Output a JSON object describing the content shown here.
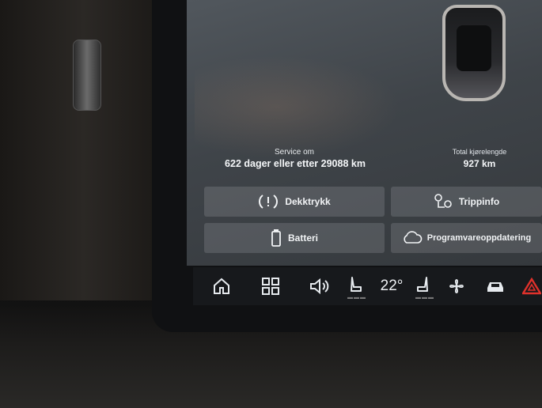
{
  "status": {
    "service_label": "Service om",
    "service_value": "622 dager eller etter 29088 km",
    "odometer_label": "Total kjørelengde",
    "odometer_value": "927 km"
  },
  "tiles": {
    "tire_pressure": "Dekktrykk",
    "trip_info": "Trippinfo",
    "battery": "Batteri",
    "software_update": "Programvareoppdatering"
  },
  "bottom_bar": {
    "temperature": "22°",
    "icons": [
      "home-icon",
      "apps-grid-icon",
      "volume-icon",
      "seat-heat-left-icon",
      "seat-heat-right-icon",
      "fan-icon",
      "car-icon",
      "hazard-icon"
    ]
  },
  "colors": {
    "screen_bg": "#3f4449",
    "tile_bg": "#4d5258",
    "bar_bg": "#17191c",
    "hazard": "#e0312b"
  }
}
